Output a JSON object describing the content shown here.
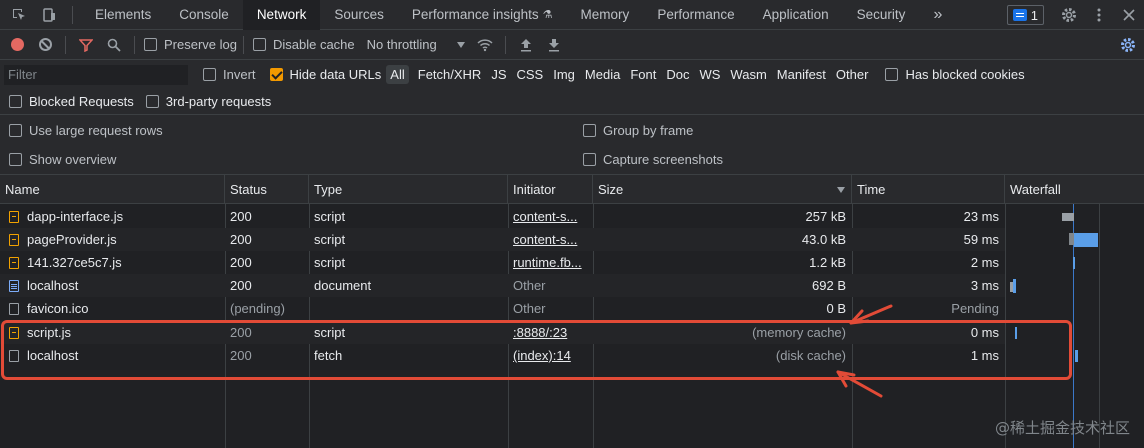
{
  "tabs": [
    {
      "label": "Elements"
    },
    {
      "label": "Console"
    },
    {
      "label": "Network",
      "active": true
    },
    {
      "label": "Sources"
    },
    {
      "label": "Performance insights"
    },
    {
      "label": "Memory"
    },
    {
      "label": "Performance"
    },
    {
      "label": "Application"
    },
    {
      "label": "Security"
    }
  ],
  "issues_count": "1",
  "toolbar": {
    "preserve_log": "Preserve log",
    "disable_cache": "Disable cache",
    "throttling": "No throttling"
  },
  "filter": {
    "placeholder": "Filter",
    "invert": "Invert",
    "hide_data_urls": "Hide data URLs",
    "types": [
      "All",
      "Fetch/XHR",
      "JS",
      "CSS",
      "Img",
      "Media",
      "Font",
      "Doc",
      "WS",
      "Wasm",
      "Manifest",
      "Other"
    ],
    "blocked_cookies": "Has blocked cookies",
    "blocked_requests": "Blocked Requests",
    "third_party": "3rd-party requests"
  },
  "settings": {
    "large_rows": "Use large request rows",
    "group_by_frame": "Group by frame",
    "show_overview": "Show overview",
    "capture_screenshots": "Capture screenshots"
  },
  "columns": {
    "name": "Name",
    "status": "Status",
    "type": "Type",
    "initiator": "Initiator",
    "size": "Size",
    "time": "Time",
    "waterfall": "Waterfall"
  },
  "rows": [
    {
      "name": "dapp-interface.js",
      "icon": "js-file-icon",
      "status": "200",
      "type": "script",
      "initiator": "content-s...",
      "size": "257 kB",
      "time": "23 ms"
    },
    {
      "name": "pageProvider.js",
      "icon": "js-file-icon",
      "status": "200",
      "type": "script",
      "initiator": "content-s...",
      "size": "43.0 kB",
      "time": "59 ms"
    },
    {
      "name": "141.327ce5c7.js",
      "icon": "js-file-icon",
      "status": "200",
      "type": "script",
      "initiator": "runtime.fb...",
      "size": "1.2 kB",
      "time": "2 ms"
    },
    {
      "name": "localhost",
      "icon": "document-icon",
      "status": "200",
      "type": "document",
      "initiator": "Other",
      "size": "692 B",
      "time": "3 ms"
    },
    {
      "name": "favicon.ico",
      "icon": "file-icon",
      "status": "(pending)",
      "type": "",
      "initiator": "Other",
      "size": "0 B",
      "time": "Pending"
    },
    {
      "name": "script.js",
      "icon": "js-file-icon",
      "status": "200",
      "type": "script",
      "initiator": ":8888/:23",
      "size": "(memory cache)",
      "time": "0 ms"
    },
    {
      "name": "localhost",
      "icon": "file-icon",
      "status": "200",
      "type": "fetch",
      "initiator": "(index):14",
      "size": "(disk cache)",
      "time": "1 ms"
    }
  ],
  "watermark": "@稀土掘金技术社区",
  "colors": {
    "accent_blue": "#8ab4f8",
    "record_red": "#e46962",
    "annotation_red": "#e24b37",
    "checkbox_orange": "#f29900"
  }
}
